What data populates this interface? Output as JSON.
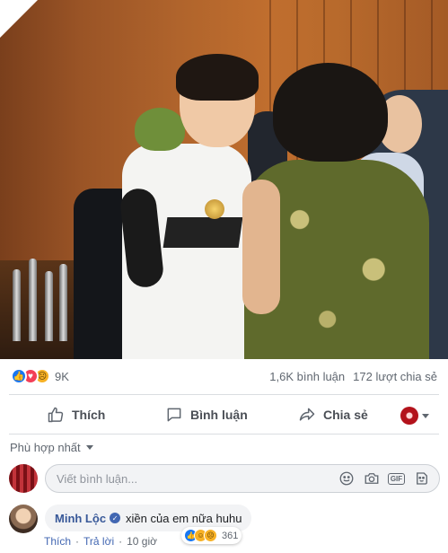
{
  "post": {
    "photo_alt": "photo",
    "reactions": {
      "icons": [
        "like-icon",
        "love-icon",
        "sad-icon"
      ],
      "count": "9K"
    },
    "comments_count": "1,6K bình luận",
    "shares_count": "172 lượt chia sẻ"
  },
  "actions": {
    "like": "Thích",
    "comment": "Bình luận",
    "share": "Chia sẻ"
  },
  "sort": {
    "label": "Phù hợp nhất"
  },
  "composer": {
    "placeholder": "Viết bình luận...",
    "tool_icons": [
      "emoji-icon",
      "camera-icon",
      "gif-icon",
      "sticker-icon"
    ],
    "gif_label": "GIF"
  },
  "comment": {
    "author": "Minh Lộc",
    "verified": true,
    "text": "xiền của em nữa huhu",
    "like_label": "Thích",
    "reply_label": "Trả lời",
    "separator": "·",
    "time": "10 giờ",
    "reaction_icons": [
      "like-icon",
      "haha-icon",
      "sad-icon"
    ],
    "reaction_count": "361"
  },
  "colors": {
    "facebook_blue": "#1877f2",
    "link_blue": "#385898",
    "text_gray": "#606770"
  }
}
